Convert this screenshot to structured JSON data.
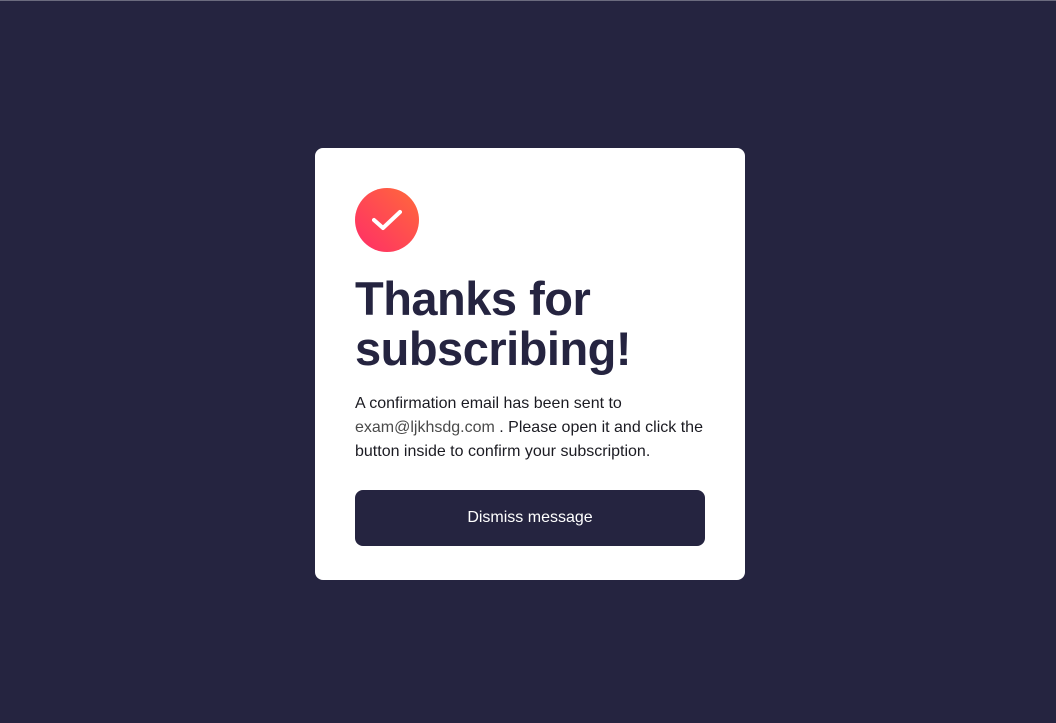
{
  "modal": {
    "title": "Thanks for subscribing!",
    "message_before": "A confirmation email has been sent to ",
    "email": "exam@ljkhsdg.com",
    "message_after": " . Please open it and click the button inside to confirm your subscription.",
    "dismiss_label": "Dismiss message",
    "icon": "check-icon"
  },
  "colors": {
    "background": "#252440",
    "card": "#ffffff",
    "accent_start": "#ff2d68",
    "accent_end": "#ff6a3a",
    "button": "#252440"
  }
}
